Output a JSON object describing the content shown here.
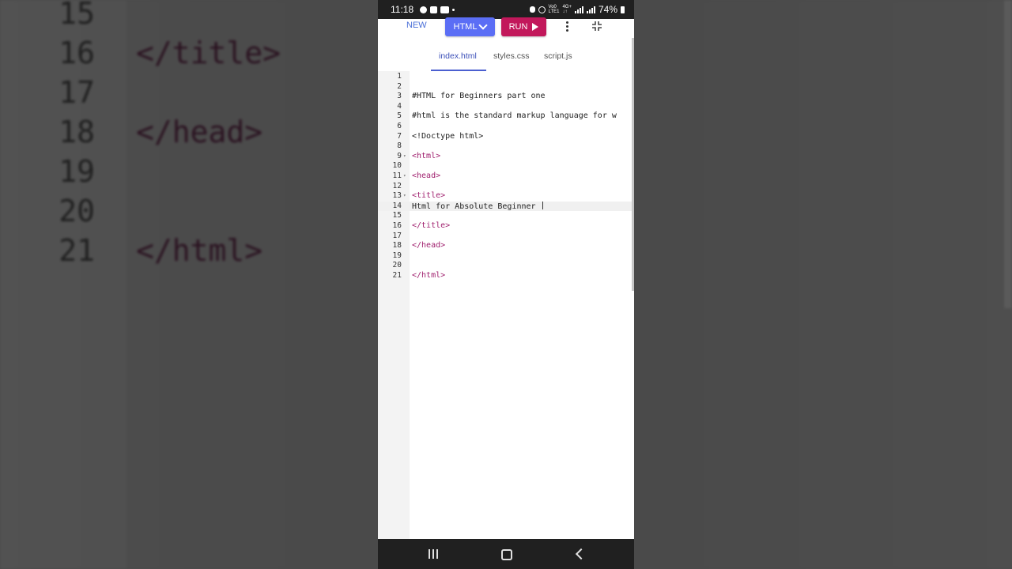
{
  "background": {
    "lines": [
      {
        "num": "15",
        "code": ""
      },
      {
        "num": "16",
        "code": "</title>"
      },
      {
        "num": "17",
        "code": ""
      },
      {
        "num": "18",
        "code": "</head>"
      },
      {
        "num": "19",
        "code": ""
      },
      {
        "num": "20",
        "code": ""
      },
      {
        "num": "21",
        "code": "</html>"
      }
    ]
  },
  "status_bar": {
    "time": "11:18",
    "battery": "74%",
    "network_top": "Vo0",
    "network_bottom": "LTE1",
    "signal_label_top": "4G+",
    "signal_label_bottom": "↓↑"
  },
  "toolbar": {
    "new_label": "NEW",
    "language_label": "HTML",
    "run_label": "RUN"
  },
  "tabs": [
    {
      "label": "index.html",
      "active": true
    },
    {
      "label": "styles.css",
      "active": false
    },
    {
      "label": "script.js",
      "active": false
    }
  ],
  "editor": {
    "current_line": 14,
    "lines": [
      {
        "num": "1",
        "code": "",
        "type": "text",
        "fold": false
      },
      {
        "num": "2",
        "code": "",
        "type": "text",
        "fold": false
      },
      {
        "num": "3",
        "code": "#HTML for Beginners part one",
        "type": "text",
        "fold": false
      },
      {
        "num": "4",
        "code": "",
        "type": "text",
        "fold": false
      },
      {
        "num": "5",
        "code": "#html is the standard markup language for w",
        "type": "text",
        "fold": false
      },
      {
        "num": "6",
        "code": "",
        "type": "text",
        "fold": false
      },
      {
        "num": "7",
        "code": "<!Doctype html>",
        "type": "text",
        "fold": false
      },
      {
        "num": "8",
        "code": "",
        "type": "text",
        "fold": false
      },
      {
        "num": "9",
        "code": "<html>",
        "type": "tag",
        "fold": true
      },
      {
        "num": "10",
        "code": "",
        "type": "text",
        "fold": false
      },
      {
        "num": "11",
        "code": "<head>",
        "type": "tag",
        "fold": true
      },
      {
        "num": "12",
        "code": "",
        "type": "text",
        "fold": false
      },
      {
        "num": "13",
        "code": "<title>",
        "type": "tag",
        "fold": true
      },
      {
        "num": "14",
        "code": "Html for Absolute Beginner",
        "type": "text",
        "fold": false
      },
      {
        "num": "15",
        "code": "",
        "type": "text",
        "fold": false
      },
      {
        "num": "16",
        "code": "</title>",
        "type": "tag",
        "fold": false
      },
      {
        "num": "17",
        "code": "",
        "type": "text",
        "fold": false
      },
      {
        "num": "18",
        "code": "</head>",
        "type": "tag",
        "fold": false
      },
      {
        "num": "19",
        "code": "",
        "type": "text",
        "fold": false
      },
      {
        "num": "20",
        "code": "",
        "type": "text",
        "fold": false
      },
      {
        "num": "21",
        "code": "</html>",
        "type": "tag",
        "fold": false
      }
    ]
  },
  "nav_bar": {
    "icons": [
      "recents-icon",
      "home-icon",
      "back-icon"
    ]
  }
}
